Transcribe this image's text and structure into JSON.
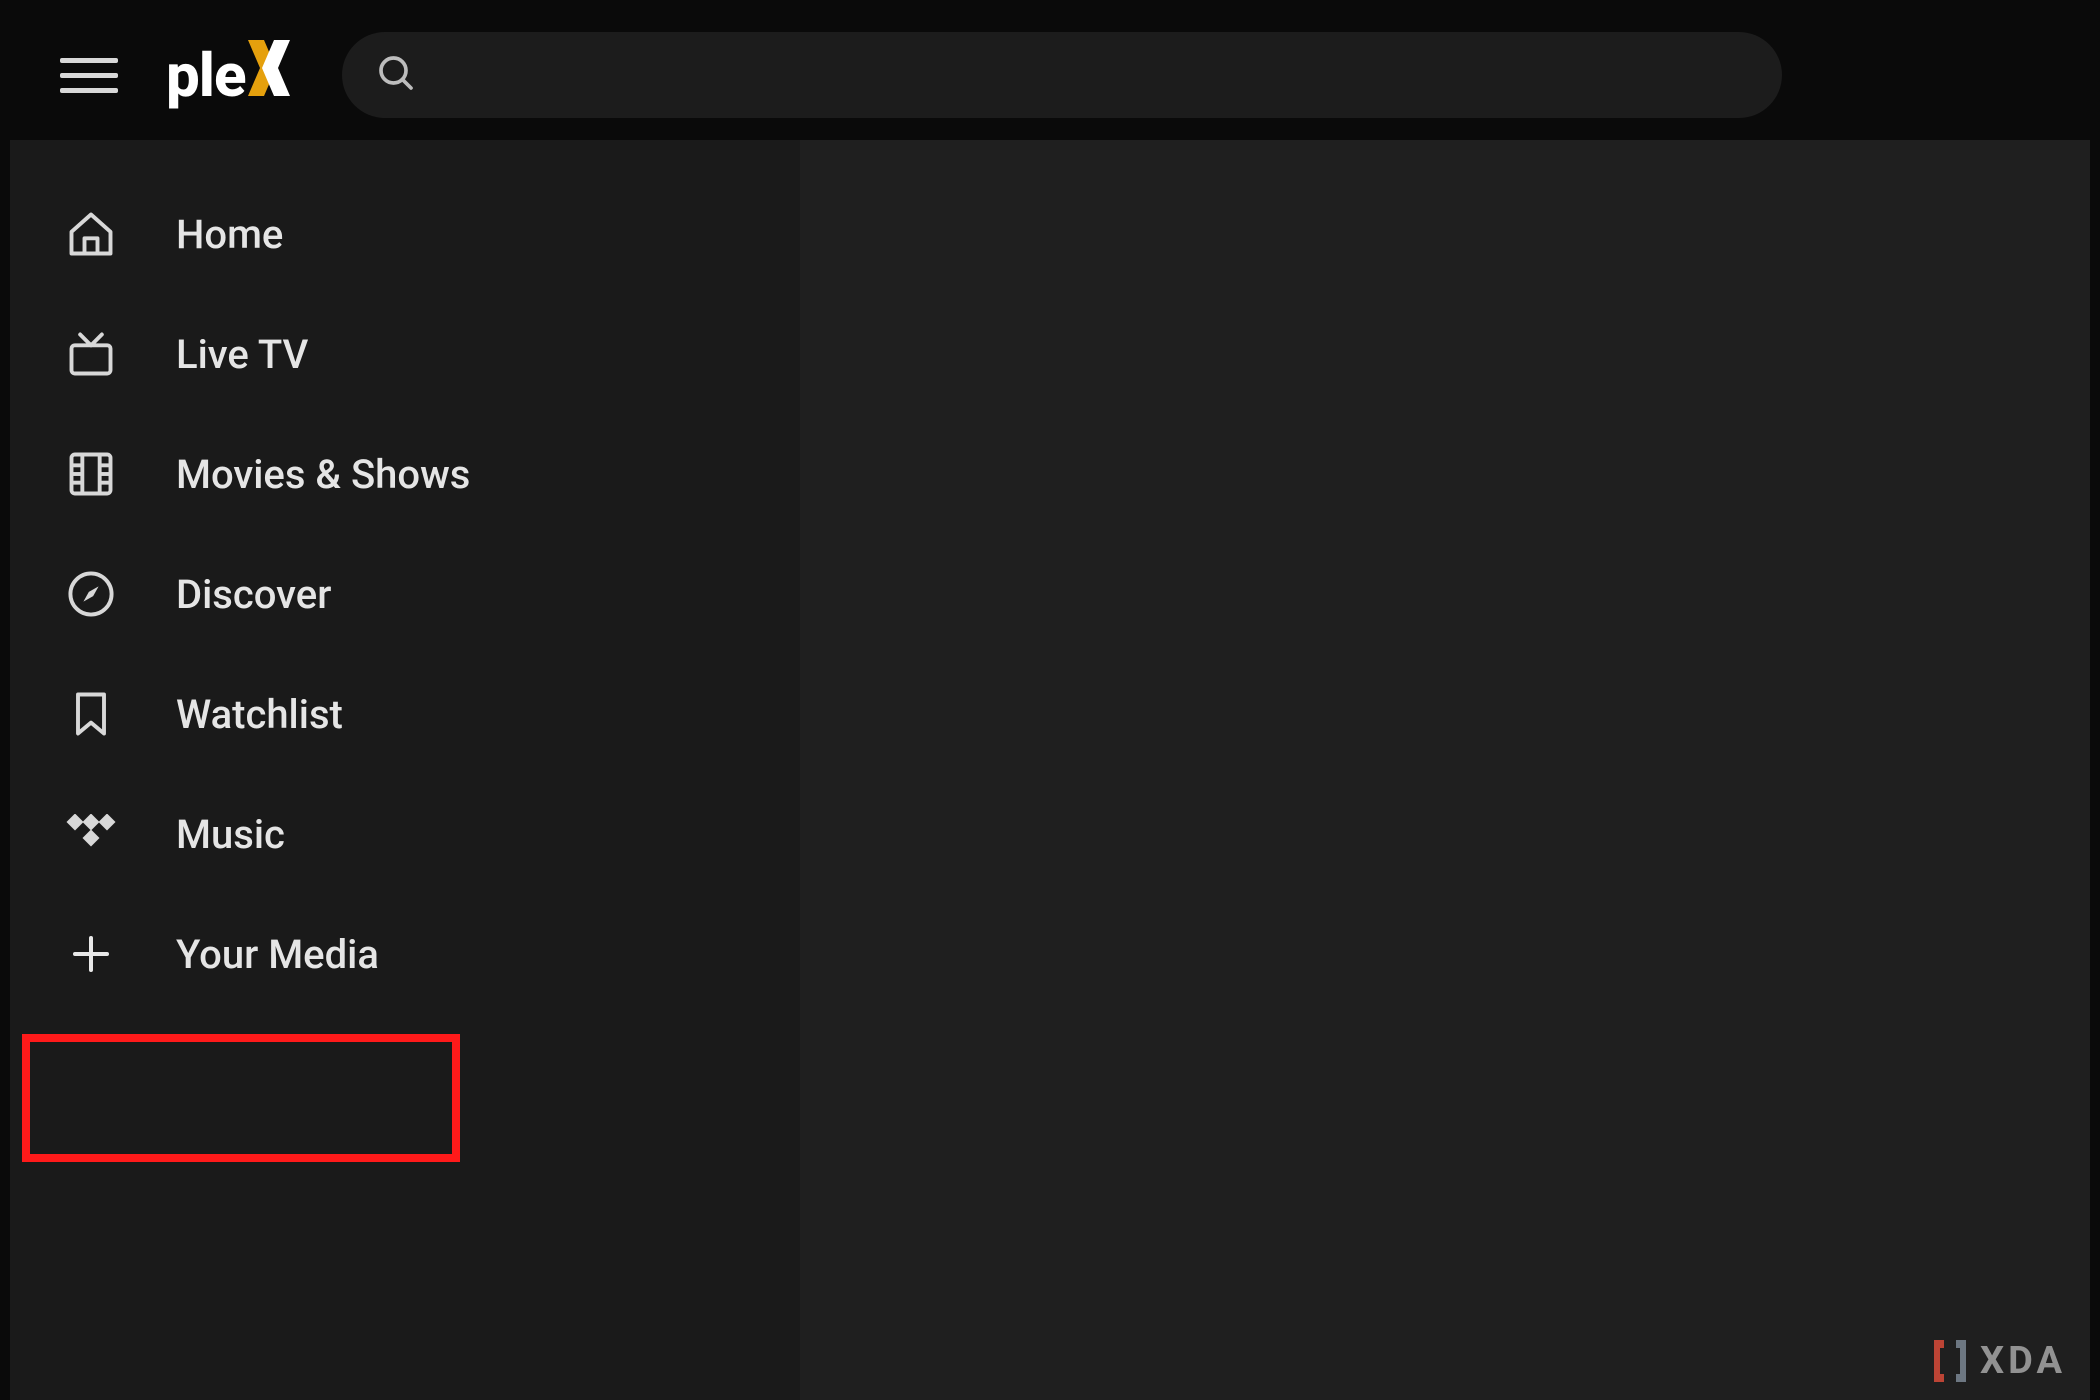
{
  "brand": {
    "name": "plex",
    "accent": "#e5a00d"
  },
  "header": {
    "search_placeholder": ""
  },
  "sidebar": {
    "items": [
      {
        "icon": "home-icon",
        "label": "Home"
      },
      {
        "icon": "livetv-icon",
        "label": "Live TV"
      },
      {
        "icon": "film-icon",
        "label": "Movies & Shows"
      },
      {
        "icon": "compass-icon",
        "label": "Discover"
      },
      {
        "icon": "bookmark-icon",
        "label": "Watchlist"
      },
      {
        "icon": "tidal-icon",
        "label": "Music"
      },
      {
        "icon": "plus-icon",
        "label": "Your Media"
      }
    ]
  },
  "highlight": {
    "item_index": 6
  },
  "watermark": {
    "text": "XDA"
  },
  "colors": {
    "bg_header": "#0a0a0a",
    "bg_sidebar": "#1a1a1a",
    "bg_content": "#1f1f1f",
    "text": "#e5e5e5",
    "highlight": "#ff1a1a"
  }
}
